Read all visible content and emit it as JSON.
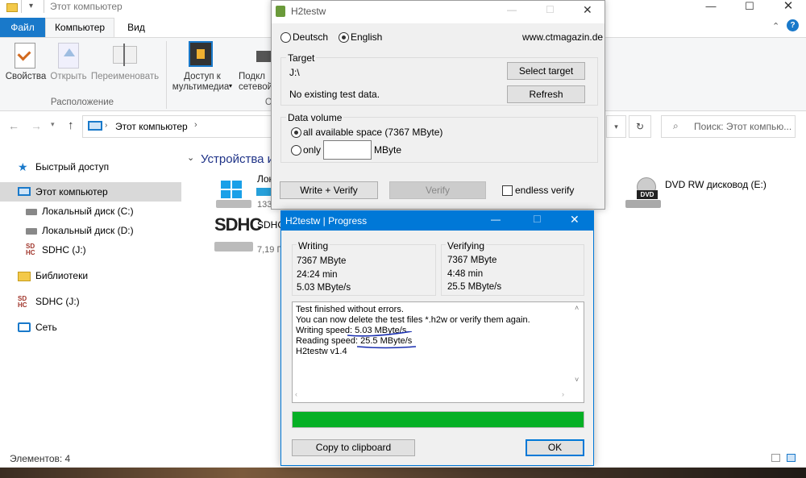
{
  "explorer": {
    "title": "Этот компьютер",
    "tabs": {
      "file": "Файл",
      "computer": "Компьютер",
      "view": "Вид"
    },
    "ribbon": {
      "properties": "Свойства",
      "open": "Открыть",
      "rename": "Переименовать",
      "media_l1": "Доступ к",
      "media_l2": "мультимедиа",
      "network_l1": "Подкл",
      "network_l2": "сетевой",
      "group_location": "Расположение",
      "group_cut": "С"
    },
    "address": {
      "path": "Этот компьютер",
      "search_placeholder": "Поиск: Этот компью..."
    },
    "nav": {
      "quick_access": "Быстрый доступ",
      "this_pc": "Этот компьютер",
      "disk_c": "Локальный диск (C:)",
      "disk_d": "Локальный диск (D:)",
      "sdhc_j": "SDHC (J:)",
      "libraries": "Библиотеки",
      "sdhc_j2": "SDHC (J:)",
      "network": "Сеть"
    },
    "section_title": "Устройства и",
    "drive_local_partial": "Лок",
    "drive_local_size_partial": "133",
    "drive_sdhc_partial": "SDHC",
    "drive_sdhc_size_partial": "7,19 Г",
    "sdhc_logo": "SDHC",
    "dvd_name": "DVD RW дисковод (E:)",
    "dvd_logo": "DVD",
    "status": "Элементов: 4"
  },
  "h2main": {
    "title": "H2testw",
    "lang_de": "Deutsch",
    "lang_en": "English",
    "website": "www.ctmagazin.de",
    "target_label": "Target",
    "target_path": "J:\\",
    "target_info": "No existing test data.",
    "select_target": "Select target",
    "refresh": "Refresh",
    "volume_label": "Data volume",
    "all_space": "all available space (7367 MByte)",
    "only": "only",
    "only_value": "",
    "mbyte": "MByte",
    "write_verify": "Write + Verify",
    "verify": "Verify",
    "endless": "endless verify"
  },
  "progress": {
    "title": "H2testw | Progress",
    "writing": {
      "label": "Writing",
      "size": "7367 MByte",
      "time": "24:24 min",
      "speed": "5.03 MByte/s"
    },
    "verifying": {
      "label": "Verifying",
      "size": "7367 MByte",
      "time": "4:48 min",
      "speed": "25.5 MByte/s"
    },
    "log": [
      "Test finished without errors.",
      "You can now delete the test files *.h2w or verify them again.",
      "Writing speed: 5.03 MByte/s",
      "Reading speed: 25.5 MByte/s",
      "H2testw v1.4"
    ],
    "progress_percent": 100,
    "bar_color": "#06b025",
    "copy": "Copy to clipboard",
    "ok": "OK"
  }
}
